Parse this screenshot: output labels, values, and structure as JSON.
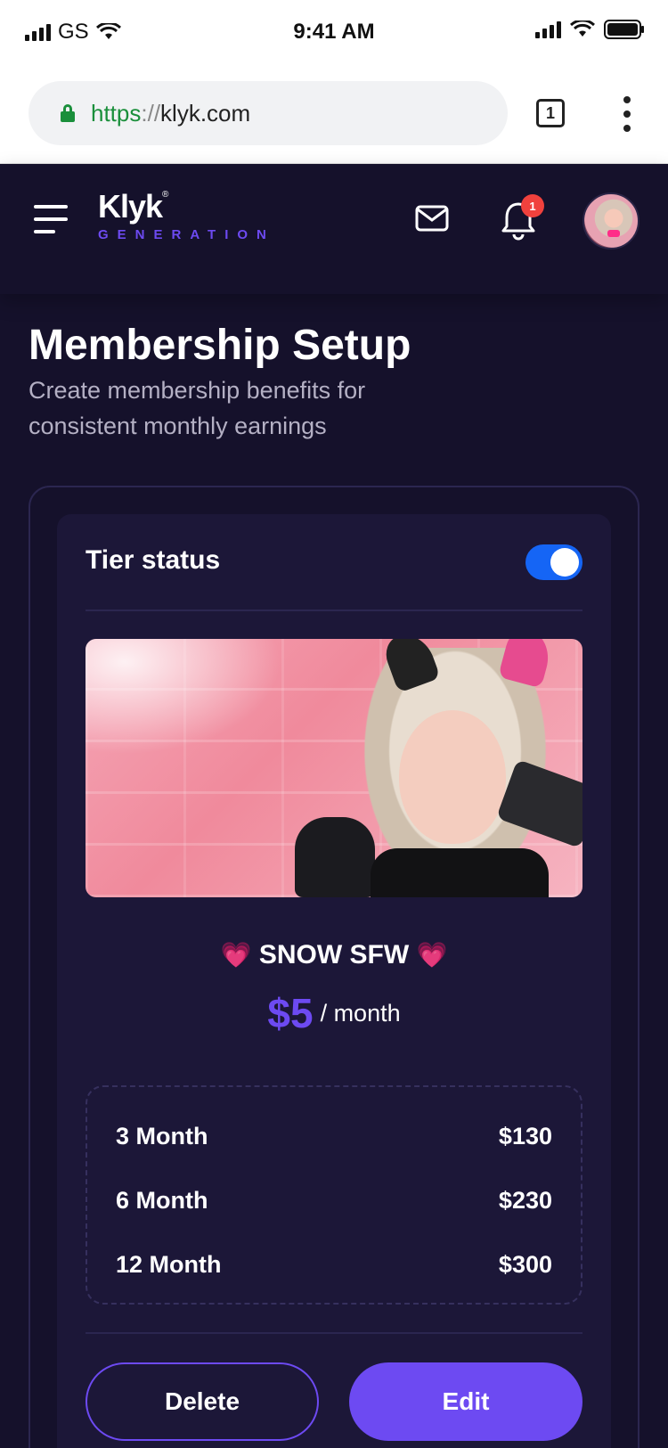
{
  "status_bar": {
    "carrier": "GS",
    "time": "9:41 AM"
  },
  "browser": {
    "url_protocol": "https",
    "url_separator": "://",
    "url_host": "klyk.com",
    "tab_count": "1"
  },
  "header": {
    "logo_text": "Klyk",
    "logo_mark": "®",
    "logo_subtitle": "GENERATION",
    "notification_count": "1"
  },
  "page": {
    "title": "Membership Setup",
    "subtitle": "Create membership benefits for consistent monthly earnings"
  },
  "tier": {
    "status_label": "Tier status",
    "enabled": true,
    "heart_left": "💗",
    "name": "SNOW SFW",
    "heart_right": "💗",
    "price": "$5",
    "period": "/ month",
    "plans": [
      {
        "duration": "3 Month",
        "price": "$130"
      },
      {
        "duration": "6 Month",
        "price": "$230"
      },
      {
        "duration": "12 Month",
        "price": "$300"
      }
    ]
  },
  "actions": {
    "delete_label": "Delete",
    "edit_label": "Edit"
  },
  "colors": {
    "background": "#15112b",
    "card": "#1c1738",
    "accent": "#6d4af2",
    "toggle_on": "#1565f5",
    "badge": "#f0413d",
    "secure": "#1a8f3b"
  }
}
